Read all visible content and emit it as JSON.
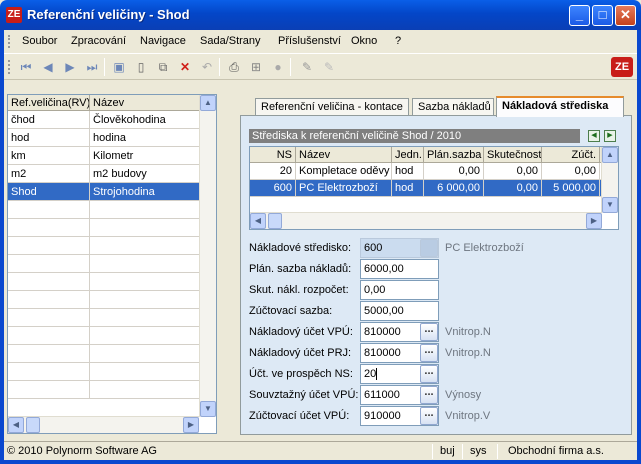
{
  "window": {
    "title": "Referenční veličiny - Shod",
    "app_icon": "ZE",
    "minimize": "_",
    "maximize": "□",
    "close": "✕"
  },
  "menu": [
    "Soubor",
    "Zpracování",
    "Navigace",
    "Sada/Strany",
    "Příslušenství",
    "Okno",
    "?"
  ],
  "toolbar": {
    "icons": [
      "first-record-icon",
      "previous-record-icon",
      "next-record-icon",
      "last-record-icon",
      "save-icon",
      "new-icon",
      "copy-icon",
      "delete-icon",
      "undo-icon",
      "print-icon",
      "tree-icon",
      "stop-icon",
      "edit-icon",
      "edit-disabled-icon"
    ],
    "brand": "ZE"
  },
  "left_grid": {
    "columns": [
      "Ref.veličina(RV)",
      "Název"
    ],
    "rows": [
      [
        "čhod",
        "Člověkohodina"
      ],
      [
        "hod",
        "hodina"
      ],
      [
        "km",
        "Kilometr"
      ],
      [
        "m2",
        "m2 budovy"
      ],
      [
        "Shod",
        "Strojohodina"
      ]
    ],
    "selected": 4,
    "empty_rows": 11
  },
  "tabs": [
    {
      "label": "Referenční veličina - kontace",
      "active": false
    },
    {
      "label": "Sazba nákladů",
      "active": false
    },
    {
      "label": "Nákladová střediska",
      "active": true
    }
  ],
  "ns_panel": {
    "title": "Střediska k referenční veličině Shod / 2010",
    "columns": [
      "NS",
      "Název",
      "Jedn.",
      "Plán.sazba",
      "Skutečnost",
      "Zúčt."
    ],
    "rows": [
      [
        "20",
        "Kompletace oděvy",
        "hod",
        "0,00",
        "0,00",
        "0,00"
      ],
      [
        "600",
        "PC Elektrozboží",
        "hod",
        "6 000,00",
        "0,00",
        "5 000,00"
      ]
    ],
    "selected": 1
  },
  "form": {
    "naklad_stredisko": {
      "label": "Nákladové středisko:",
      "value": "600",
      "desc": "PC Elektrozboží"
    },
    "plan_sazba": {
      "label": "Plán. sazba nákladů:",
      "value": "6000,00"
    },
    "skut_rozpocet": {
      "label": "Skut. nákl. rozpočet:",
      "value": "0,00"
    },
    "zuct_sazba": {
      "label": "Zúčtovací sazba:",
      "value": "5000,00"
    },
    "ucet_vpu": {
      "label": "Nákladový účet VPÚ:",
      "value": "810000",
      "desc": "Vnitrop.N"
    },
    "ucet_prj": {
      "label": "Nákladový účet PRJ:",
      "value": "810000",
      "desc": "Vnitrop.N"
    },
    "ucet_ns": {
      "label": "Účt. ve prospěch NS:",
      "value": "20",
      "desc": ""
    },
    "souv_ucet": {
      "label": "Souvztažný účet VPÚ:",
      "value": "611000",
      "desc": "Výnosy"
    },
    "zuct_ucet": {
      "label": "Zúčtovací účet VPÚ:",
      "value": "910000",
      "desc": "Vnitrop.V"
    },
    "browse_label": "..."
  },
  "status": {
    "copyright": "© 2010 Polynorm Software AG",
    "user": "buj",
    "db": "sys",
    "company": "Obchodní firma a.s."
  },
  "colors": {
    "selection": "#316ac5",
    "title_bar": "#0a5fe8",
    "panel_bg": "#dde9f5",
    "active_tab_accent": "#e68b2c"
  }
}
